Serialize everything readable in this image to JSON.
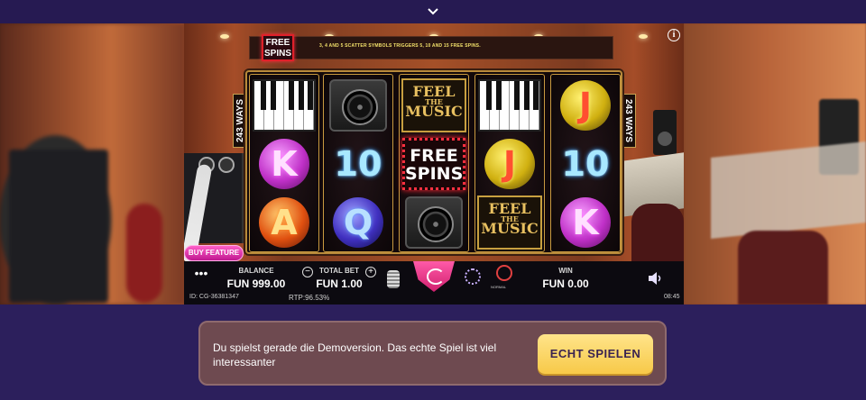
{
  "topbar": {
    "toggle_icon": "chevron-down-icon"
  },
  "game": {
    "free_spins_badge": "FREE SPINS",
    "message": "3, 4 AND 5 SCATTER SYMBOLS TRIGGERS 5, 10 AND 15 FREE SPINS.",
    "ways_left": "243 WAYS",
    "ways_right": "243 WAYS",
    "info_label": "i",
    "buy_feature_label": "BUY FEATURE",
    "reels": [
      [
        "piano",
        "K",
        "A"
      ],
      [
        "speaker",
        "10",
        "Q"
      ],
      [
        "feel-the-music",
        "free-spins",
        "speaker"
      ],
      [
        "piano",
        "J",
        "feel-the-music"
      ],
      [
        "J",
        "10",
        "K"
      ]
    ],
    "symbols": {
      "feel_line1": "FEEL",
      "feel_line2": "THE",
      "feel_line3": "MUSIC",
      "fs_line1": "FREE",
      "fs_line2": "SPINS",
      "K": "K",
      "A": "A",
      "Q": "Q",
      "J": "J",
      "ten": "10"
    }
  },
  "hud": {
    "menu_label": "•••",
    "balance_label": "BALANCE",
    "balance_value": "FUN 999.00",
    "total_bet_label": "TOTAL BET",
    "total_bet_value": "FUN 1.00",
    "bet_minus": "−",
    "bet_plus": "+",
    "speed_label": "NORMAL",
    "win_label": "WIN",
    "win_value": "FUN 0.00",
    "id_text": "ID: CG-36381347",
    "rtp_text": "RTP:96.53%",
    "clock": "08:45"
  },
  "banner": {
    "text": "Du spielst gerade die Demoversion. Das echte Spiel ist viel interessanter",
    "cta_label": "ECHT SPIELEN"
  },
  "colors": {
    "background": "#2c1f5c",
    "cta": "#f7c948",
    "banner": "#6e4a50",
    "spin": "#e0307e"
  }
}
